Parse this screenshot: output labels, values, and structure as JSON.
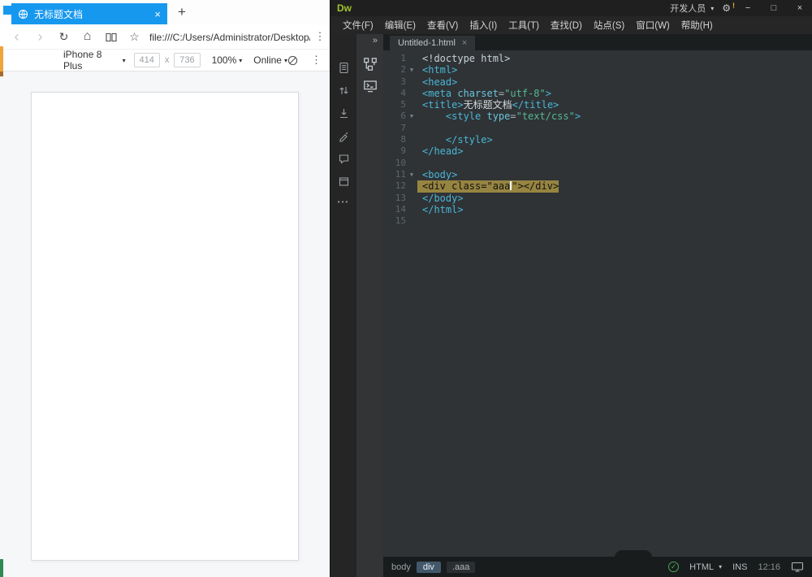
{
  "colors": {
    "edge_blue": "#1798ef",
    "dw_logo_green": "#9fc32a",
    "code_tag": "#4ab6d8",
    "code_value": "#57b993",
    "highlight_bg": "#968441",
    "lint_green": "#46a758"
  },
  "browser": {
    "tab": {
      "title": "无标题文档",
      "close": "×"
    },
    "new_tab": "+",
    "nav": {
      "back": "‹",
      "forward": "›",
      "refresh": "↻",
      "home": "⌂",
      "star": "☆",
      "more": "⋮",
      "address": "file:///C:/Users/Administrator/Desktop/新"
    },
    "device_bar": {
      "device": "iPhone 8 Plus",
      "caret": "▾",
      "width": "414",
      "times": "x",
      "height": "736",
      "zoom": "100%",
      "network": "Online",
      "more": "⋮"
    }
  },
  "dw": {
    "logo": "Dw",
    "titlebar": {
      "workspace": "开发人员",
      "workspace_caret": "▾",
      "gear": "⚙",
      "gear_badge": "!",
      "minimize": "−",
      "maximize": "□",
      "close": "×"
    },
    "menus": [
      "文件(F)",
      "编辑(E)",
      "查看(V)",
      "插入(I)",
      "工具(T)",
      "查找(D)",
      "站点(S)",
      "窗口(W)",
      "帮助(H)"
    ],
    "tool_icons": [
      "open-documents-icon",
      "file-management-icon",
      "live-code-icon",
      "format-source-icon",
      "apply-comment-icon",
      "inspect-window-icon",
      "customize-toolbar-icon"
    ],
    "customize_glyph": "•••",
    "panel": {
      "collapse": "»",
      "icons": [
        "structure-panel-icon",
        "snippets-panel-icon"
      ]
    },
    "doc_tab": {
      "name": "Untitled-1.html",
      "close": "×"
    },
    "code": {
      "fold_glyph": "▼",
      "lines": [
        {
          "n": 1,
          "segments": [
            {
              "t": "doc",
              "s": "<!doctype html>"
            }
          ]
        },
        {
          "n": 2,
          "fold": true,
          "segments": [
            {
              "t": "tag",
              "s": "<html>"
            }
          ]
        },
        {
          "n": 3,
          "segments": [
            {
              "t": "tag",
              "s": "<head>"
            }
          ]
        },
        {
          "n": 4,
          "segments": [
            {
              "t": "tag",
              "s": "<meta"
            },
            {
              "t": "attr",
              "s": " charset"
            },
            {
              "t": "punct",
              "s": "="
            },
            {
              "t": "val",
              "s": "\"utf-8\""
            },
            {
              "t": "tag",
              "s": ">"
            }
          ]
        },
        {
          "n": 5,
          "segments": [
            {
              "t": "tag",
              "s": "<title>"
            },
            {
              "t": "txt",
              "s": "无标题文档"
            },
            {
              "t": "tag",
              "s": "</title>"
            }
          ]
        },
        {
          "n": 6,
          "fold": true,
          "segments": [
            {
              "t": "tag",
              "s": "    <style"
            },
            {
              "t": "attr",
              "s": " type"
            },
            {
              "t": "punct",
              "s": "="
            },
            {
              "t": "val",
              "s": "\"text/css\""
            },
            {
              "t": "tag",
              "s": ">"
            }
          ]
        },
        {
          "n": 7,
          "segments": []
        },
        {
          "n": 8,
          "segments": [
            {
              "t": "tag",
              "s": "    </style>"
            }
          ]
        },
        {
          "n": 9,
          "segments": [
            {
              "t": "tag",
              "s": "</head>"
            }
          ]
        },
        {
          "n": 10,
          "segments": []
        },
        {
          "n": 11,
          "fold": true,
          "segments": [
            {
              "t": "tag",
              "s": "<body>"
            }
          ]
        },
        {
          "n": 12,
          "highlight": true,
          "segments": [
            {
              "t": "hl",
              "s": "<div class=\"aaa"
            },
            {
              "t": "caret"
            },
            {
              "t": "hl",
              "s": "\"></div>"
            }
          ]
        },
        {
          "n": 13,
          "segments": [
            {
              "t": "tag",
              "s": "</body>"
            }
          ]
        },
        {
          "n": 14,
          "segments": [
            {
              "t": "tag",
              "s": "</html>"
            }
          ]
        },
        {
          "n": 15,
          "segments": []
        }
      ]
    },
    "statusbar": {
      "crumbs": [
        {
          "label": "body",
          "style": "plain"
        },
        {
          "label": "div",
          "style": "pill-blue"
        },
        {
          "label": ".aaa",
          "style": "pill-dark"
        }
      ],
      "check": "✓",
      "doctype": "HTML",
      "caret": "▾",
      "mode": "INS",
      "position": "12:16"
    }
  }
}
